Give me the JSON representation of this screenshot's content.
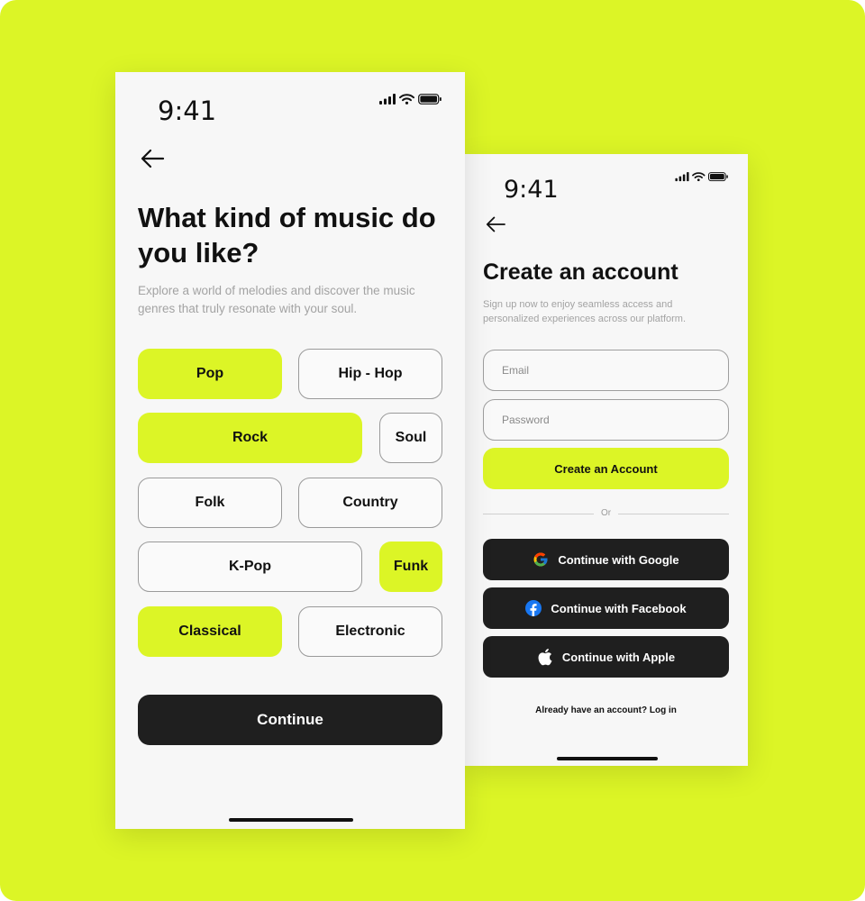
{
  "genre_screen": {
    "time": "9:41",
    "title": "What kind of music do you like?",
    "subtitle": "Explore a world of melodies and discover the music genres that truly resonate with your soul.",
    "genres": [
      {
        "label": "Pop",
        "selected": true
      },
      {
        "label": "Hip - Hop",
        "selected": false
      },
      {
        "label": "Rock",
        "selected": true
      },
      {
        "label": "Soul",
        "selected": false
      },
      {
        "label": "Folk",
        "selected": false
      },
      {
        "label": "Country",
        "selected": false
      },
      {
        "label": "K-Pop",
        "selected": false
      },
      {
        "label": "Funk",
        "selected": true
      },
      {
        "label": "Classical",
        "selected": true
      },
      {
        "label": "Electronic",
        "selected": false
      }
    ],
    "continue_label": "Continue"
  },
  "signup_screen": {
    "time": "9:41",
    "title": "Create an account",
    "subtitle": "Sign up now to enjoy seamless access and personalized experiences across our platform.",
    "email_placeholder": "Email",
    "password_placeholder": "Password",
    "create_label": "Create an Account",
    "or_label": "Or",
    "google_label": "Continue with Google",
    "facebook_label": "Continue with Facebook",
    "apple_label": "Continue with Apple",
    "login_prompt": "Already have an account? ",
    "login_link": "Log in"
  },
  "colors": {
    "accent": "#dcf526",
    "dark": "#1f1f1f",
    "screen_bg": "#f7f7f7"
  }
}
